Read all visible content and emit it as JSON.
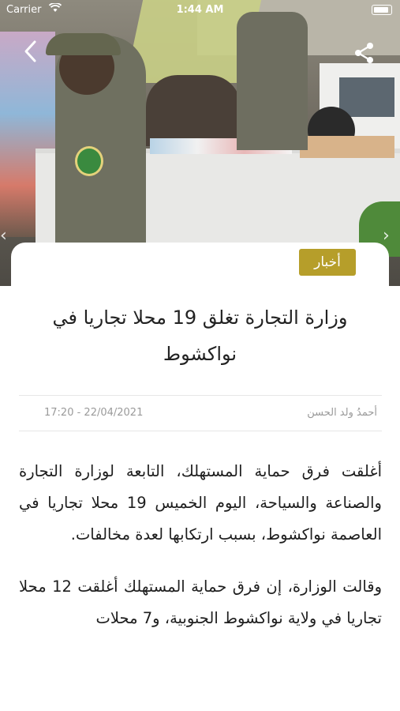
{
  "status_bar": {
    "carrier": "Carrier",
    "time": "1:44 AM"
  },
  "article": {
    "category": "أخبار",
    "title": "وزارة التجارة تغلق 19 محلا تجاريا في نواكشوط",
    "author": "أحمدُ ولد الحسن",
    "date": "17:20 - 22/04/2021",
    "paragraphs": [
      "أغلقت فرق حماية المستهلك، التابعة لوزارة التجارة والصناعة والسياحة، اليوم الخميس 19 محلا تجاريا في العاصمة نواكشوط، بسبب ارتكابها لعدة مخالفات.",
      "وقالت الوزارة، إن فرق حماية المستهلك أغلقت 12 محلا تجاريا في ولاية نواكشوط الجنوبية، و7 محلات"
    ]
  },
  "colors": {
    "badge": "#b69e2a",
    "status_text": "#ffffff"
  },
  "icons": {
    "back": "chevron-left-icon",
    "share": "share-icon",
    "wifi": "wifi-icon",
    "battery": "battery-icon"
  }
}
